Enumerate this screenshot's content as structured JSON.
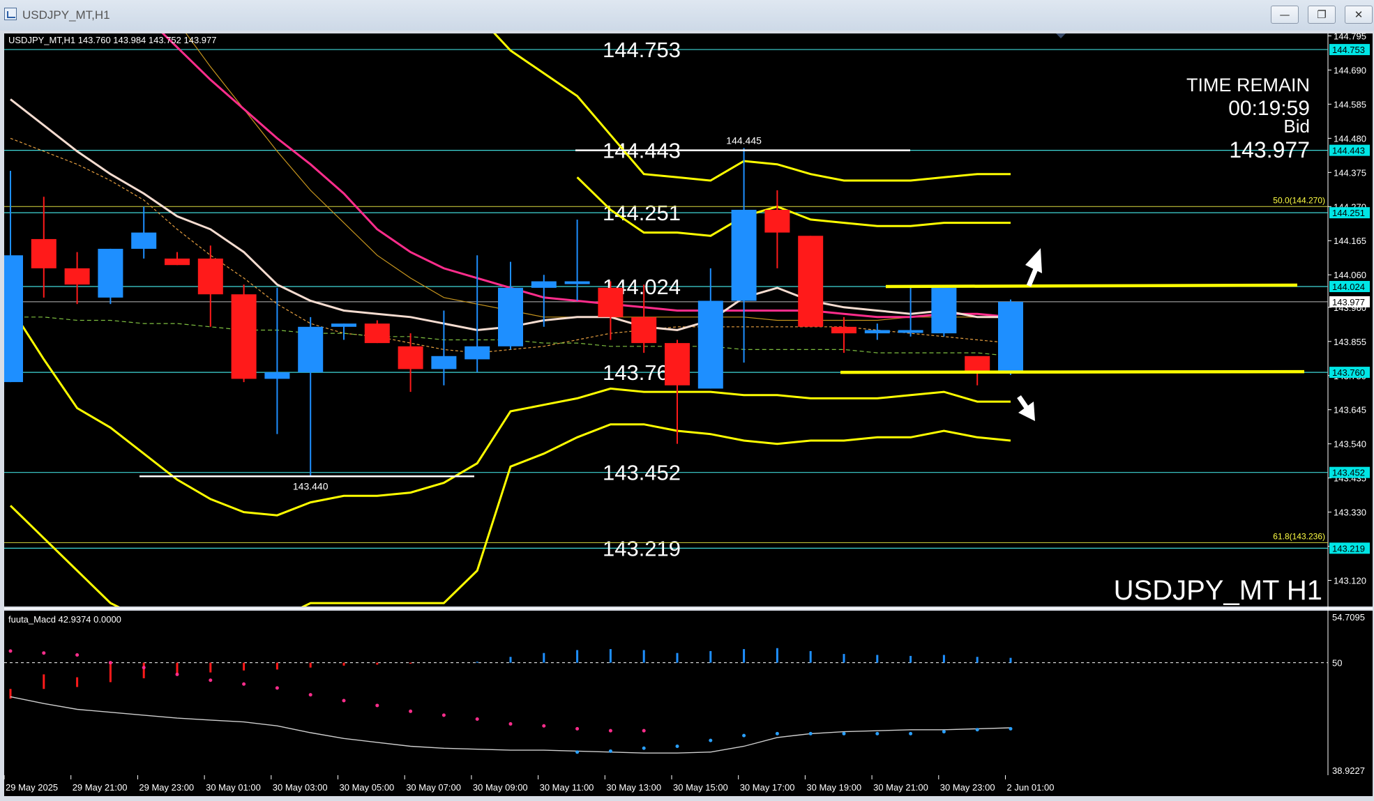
{
  "window": {
    "title": "USDJPY_MT,H1",
    "minimize_icon": "minimize-icon",
    "restore_icon": "restore-icon",
    "close_icon": "close-icon"
  },
  "chart_info": {
    "symbol_line": "USDJPY_MT,H1  143.760 143.984 143.752 143.977",
    "watermark": "USDJPY_MT H1",
    "time_remain_label": "TIME REMAIN",
    "time_remain_value": "00:19:59",
    "bid_label": "Bid",
    "bid_value": "143.977"
  },
  "price_axis": {
    "ticks": [
      "144.795",
      "144.690",
      "144.585",
      "144.480",
      "144.375",
      "144.270",
      "144.165",
      "144.060",
      "143.960",
      "143.855",
      "143.750",
      "143.645",
      "143.540",
      "143.435",
      "143.330",
      "143.225",
      "143.120"
    ],
    "tags": [
      {
        "price": 144.753,
        "label": "144.753",
        "color": "#00e5e5",
        "text_color": "#000000"
      },
      {
        "price": 144.443,
        "label": "144.443",
        "color": "#00e5e5",
        "text_color": "#000000"
      },
      {
        "price": 144.251,
        "label": "144.251",
        "color": "#00e5e5",
        "text_color": "#000000"
      },
      {
        "price": 144.024,
        "label": "144.024",
        "color": "#00e5e5",
        "text_color": "#000000"
      },
      {
        "price": 143.977,
        "label": "143.977",
        "color": "#ffffff",
        "text_color": "#000000"
      },
      {
        "price": 143.76,
        "label": "143.760",
        "color": "#00e5e5",
        "text_color": "#000000"
      },
      {
        "price": 143.452,
        "label": "143.452",
        "color": "#00e5e5",
        "text_color": "#000000"
      },
      {
        "price": 143.219,
        "label": "143.219",
        "color": "#00e5e5",
        "text_color": "#000000"
      }
    ]
  },
  "horizontal_levels": [
    {
      "price": 144.753,
      "label": "144.753"
    },
    {
      "price": 144.443,
      "label": "144.443"
    },
    {
      "price": 144.251,
      "label": "144.251"
    },
    {
      "price": 144.024,
      "label": "144.024"
    },
    {
      "price": 143.76,
      "label": "143.760"
    },
    {
      "price": 143.452,
      "label": "143.452"
    },
    {
      "price": 143.219,
      "label": "143.219"
    }
  ],
  "fibo_labels": [
    {
      "price": 144.27,
      "label": "50.0(144.270)"
    },
    {
      "price": 143.236,
      "label": "61.8(143.236)"
    }
  ],
  "swing_labels": [
    {
      "price": 144.445,
      "label": "144.445",
      "bar": 22
    },
    {
      "price": 143.44,
      "label": "143.440",
      "bar": 9
    }
  ],
  "time_axis": {
    "labels": [
      "29 May 2025",
      "29 May 21:00",
      "29 May 23:00",
      "30 May 01:00",
      "30 May 03:00",
      "30 May 05:00",
      "30 May 07:00",
      "30 May 09:00",
      "30 May 11:00",
      "30 May 13:00",
      "30 May 15:00",
      "30 May 17:00",
      "30 May 19:00",
      "30 May 21:00",
      "30 May 23:00",
      "2 Jun 01:00"
    ]
  },
  "macd": {
    "label": "fuuta_Macd 42.9374   0.0000",
    "ticks": [
      "54.7095",
      "50",
      "38.9227"
    ],
    "level": 50,
    "range": [
      38.9227,
      54.7095
    ]
  },
  "colors": {
    "background": "#000000",
    "bull": "#1e8fff",
    "bear": "#ff1a1a",
    "level_line": "#40d8d8",
    "band": "#ffff00",
    "ma_white": "#f5dcd0",
    "ma_pink": "#ff2d8c",
    "support_resistance": "#ffff00"
  },
  "chart_data": {
    "type": "candlestick",
    "title": "USDJPY_MT,H1",
    "ylim": [
      143.12,
      144.8
    ],
    "candles": [
      {
        "o": 143.73,
        "h": 144.38,
        "l": 143.73,
        "c": 144.12
      },
      {
        "o": 144.17,
        "h": 144.3,
        "l": 143.99,
        "c": 144.08
      },
      {
        "o": 144.08,
        "h": 144.13,
        "l": 143.97,
        "c": 144.03
      },
      {
        "o": 143.99,
        "h": 144.14,
        "l": 143.97,
        "c": 144.14
      },
      {
        "o": 144.14,
        "h": 144.27,
        "l": 144.11,
        "c": 144.19
      },
      {
        "o": 144.11,
        "h": 144.13,
        "l": 144.09,
        "c": 144.09
      },
      {
        "o": 144.11,
        "h": 144.15,
        "l": 143.9,
        "c": 144.0
      },
      {
        "o": 144.0,
        "h": 144.03,
        "l": 143.73,
        "c": 143.74
      },
      {
        "o": 143.74,
        "h": 144.02,
        "l": 143.57,
        "c": 143.76
      },
      {
        "o": 143.76,
        "h": 143.93,
        "l": 143.44,
        "c": 143.9
      },
      {
        "o": 143.9,
        "h": 143.91,
        "l": 143.86,
        "c": 143.91
      },
      {
        "o": 143.91,
        "h": 143.92,
        "l": 143.85,
        "c": 143.85
      },
      {
        "o": 143.84,
        "h": 143.88,
        "l": 143.7,
        "c": 143.77
      },
      {
        "o": 143.77,
        "h": 143.95,
        "l": 143.72,
        "c": 143.81
      },
      {
        "o": 143.8,
        "h": 144.12,
        "l": 143.76,
        "c": 143.84
      },
      {
        "o": 143.84,
        "h": 144.1,
        "l": 143.83,
        "c": 144.02
      },
      {
        "o": 144.02,
        "h": 144.06,
        "l": 143.9,
        "c": 144.04
      },
      {
        "o": 144.04,
        "h": 144.23,
        "l": 143.98,
        "c": 144.04
      },
      {
        "o": 144.02,
        "h": 144.04,
        "l": 143.86,
        "c": 143.93
      },
      {
        "o": 143.93,
        "h": 144.03,
        "l": 143.82,
        "c": 143.85
      },
      {
        "o": 143.85,
        "h": 143.86,
        "l": 143.54,
        "c": 143.72
      },
      {
        "o": 143.71,
        "h": 144.08,
        "l": 143.71,
        "c": 143.98
      },
      {
        "o": 143.98,
        "h": 144.45,
        "l": 143.79,
        "c": 144.26
      },
      {
        "o": 144.26,
        "h": 144.32,
        "l": 144.08,
        "c": 144.19
      },
      {
        "o": 144.18,
        "h": 144.18,
        "l": 143.9,
        "c": 143.9
      },
      {
        "o": 143.9,
        "h": 143.93,
        "l": 143.82,
        "c": 143.88
      },
      {
        "o": 143.88,
        "h": 143.91,
        "l": 143.86,
        "c": 143.89
      },
      {
        "o": 143.89,
        "h": 144.02,
        "l": 143.87,
        "c": 143.89
      },
      {
        "o": 143.88,
        "h": 144.02,
        "l": 143.87,
        "c": 144.02
      },
      {
        "o": 143.81,
        "h": 143.81,
        "l": 143.72,
        "c": 143.76
      },
      {
        "o": 143.76,
        "h": 143.984,
        "l": 143.752,
        "c": 143.977
      }
    ],
    "band_outer_upper": [
      null,
      null,
      null,
      null,
      null,
      null,
      null,
      null,
      null,
      null,
      null,
      null,
      null,
      145.0,
      144.86,
      144.75,
      144.68,
      144.61,
      144.49,
      144.37,
      144.36,
      144.35,
      144.41,
      144.4,
      144.37,
      144.35,
      144.35,
      144.35,
      144.36,
      144.37,
      144.37
    ],
    "band_inner_upper": [
      null,
      null,
      null,
      null,
      null,
      null,
      null,
      null,
      null,
      null,
      null,
      null,
      null,
      null,
      null,
      null,
      null,
      144.36,
      144.26,
      144.19,
      144.19,
      144.18,
      144.24,
      144.27,
      144.23,
      144.22,
      144.21,
      144.21,
      144.22,
      144.22,
      144.22
    ],
    "band_inner_lower": [
      143.96,
      143.8,
      143.65,
      143.59,
      143.51,
      143.43,
      143.37,
      143.33,
      143.32,
      143.36,
      143.38,
      143.38,
      143.39,
      143.42,
      143.48,
      143.64,
      143.66,
      143.68,
      143.71,
      143.7,
      143.7,
      143.7,
      143.69,
      143.69,
      143.68,
      143.68,
      143.68,
      143.69,
      143.7,
      143.67,
      143.67
    ],
    "band_outer_lower": [
      143.35,
      143.25,
      143.15,
      143.05,
      143.0,
      143.0,
      143.0,
      143.0,
      143.0,
      143.05,
      143.05,
      143.05,
      143.05,
      143.05,
      143.15,
      143.47,
      143.51,
      143.56,
      143.6,
      143.6,
      143.58,
      143.57,
      143.55,
      143.54,
      143.55,
      143.55,
      143.56,
      143.56,
      143.58,
      143.56,
      143.55
    ],
    "ma_white": [
      144.6,
      144.52,
      144.44,
      144.37,
      144.31,
      144.24,
      144.2,
      144.13,
      144.03,
      143.98,
      143.95,
      143.94,
      143.93,
      143.91,
      143.89,
      143.9,
      143.92,
      143.93,
      143.93,
      143.9,
      143.89,
      143.92,
      143.99,
      144.02,
      143.98,
      143.96,
      143.95,
      143.94,
      143.95,
      143.93,
      143.93
    ],
    "ma_pink": [
      145.1,
      145.05,
      145.0,
      144.94,
      144.86,
      144.76,
      144.66,
      144.57,
      144.48,
      144.4,
      144.31,
      144.2,
      144.13,
      144.08,
      144.05,
      144.02,
      143.99,
      143.98,
      143.97,
      143.96,
      143.95,
      143.95,
      143.95,
      143.95,
      143.95,
      143.94,
      143.93,
      143.93,
      143.94,
      143.94,
      143.93
    ],
    "ma_tan_dashed": [
      144.48,
      144.44,
      144.4,
      144.35,
      144.29,
      144.2,
      144.12,
      144.05,
      143.97,
      143.91,
      143.88,
      143.87,
      143.85,
      143.83,
      143.82,
      143.83,
      143.84,
      143.86,
      143.88,
      143.89,
      143.9,
      143.9,
      143.9,
      143.9,
      143.9,
      143.9,
      143.89,
      143.88,
      143.87,
      143.86,
      143.85
    ],
    "ma_orange": [
      145.6,
      145.45,
      145.3,
      145.12,
      144.98,
      144.84,
      144.7,
      144.57,
      144.44,
      144.32,
      144.22,
      144.12,
      144.05,
      143.99,
      143.97,
      143.95,
      143.93,
      143.93,
      143.93,
      143.93,
      143.93,
      143.93,
      143.93,
      143.92,
      143.92,
      143.92,
      143.92,
      143.93,
      143.93,
      143.93,
      143.93
    ],
    "ma_green_dashed": [
      143.93,
      143.93,
      143.92,
      143.92,
      143.91,
      143.91,
      143.9,
      143.89,
      143.89,
      143.88,
      143.88,
      143.87,
      143.87,
      143.86,
      143.86,
      143.86,
      143.85,
      143.85,
      143.84,
      143.84,
      143.84,
      143.84,
      143.83,
      143.83,
      143.83,
      143.83,
      143.82,
      143.82,
      143.82,
      143.82,
      143.81
    ],
    "macd_hist": [
      46.3,
      47.3,
      47.5,
      48.0,
      48.4,
      48.8,
      49.0,
      49.2,
      49.3,
      49.5,
      49.7,
      49.8,
      49.9,
      50.0,
      50.1,
      50.6,
      51.0,
      51.3,
      51.4,
      51.3,
      51.0,
      51.2,
      51.4,
      51.5,
      51.2,
      50.9,
      50.8,
      50.7,
      50.8,
      50.6,
      50.5
    ],
    "macd_hist_top": [
      47.3,
      48.8,
      48.5,
      50.0,
      50.0,
      50.0,
      50.0,
      50.0,
      50.0,
      50.0,
      50.0,
      50.0,
      50.0,
      50.0,
      50.0,
      50.0,
      50.0,
      50.0,
      50.0,
      50.0,
      50.0,
      50.0,
      50.0,
      50.0,
      50.0,
      50.0,
      50.0,
      50.0,
      50.0,
      50.0,
      50.0
    ],
    "macd_signal_dots": [
      51.2,
      51.0,
      50.8,
      50.0,
      49.5,
      48.8,
      48.2,
      47.8,
      47.4,
      46.7,
      46.1,
      45.6,
      45.0,
      44.6,
      44.2,
      43.7,
      43.5,
      43.2,
      43.0,
      43.0,
      null,
      null,
      null,
      null,
      null,
      null,
      null,
      null,
      null,
      null,
      null
    ],
    "macd_signal_dots_blue": [
      null,
      null,
      null,
      null,
      null,
      null,
      null,
      null,
      null,
      null,
      null,
      null,
      null,
      null,
      null,
      null,
      null,
      40.8,
      40.9,
      41.2,
      41.4,
      42.0,
      42.5,
      42.7,
      42.7,
      42.7,
      42.7,
      42.7,
      42.9,
      43.1,
      43.2
    ],
    "macd_line": [
      46.5,
      45.8,
      45.2,
      44.9,
      44.6,
      44.3,
      44.1,
      43.9,
      43.5,
      42.8,
      42.2,
      41.8,
      41.4,
      41.2,
      41.1,
      41.0,
      41.0,
      40.9,
      40.8,
      40.7,
      40.7,
      40.8,
      41.4,
      42.3,
      42.7,
      42.9,
      43.0,
      43.1,
      43.1,
      43.2,
      43.3
    ]
  }
}
